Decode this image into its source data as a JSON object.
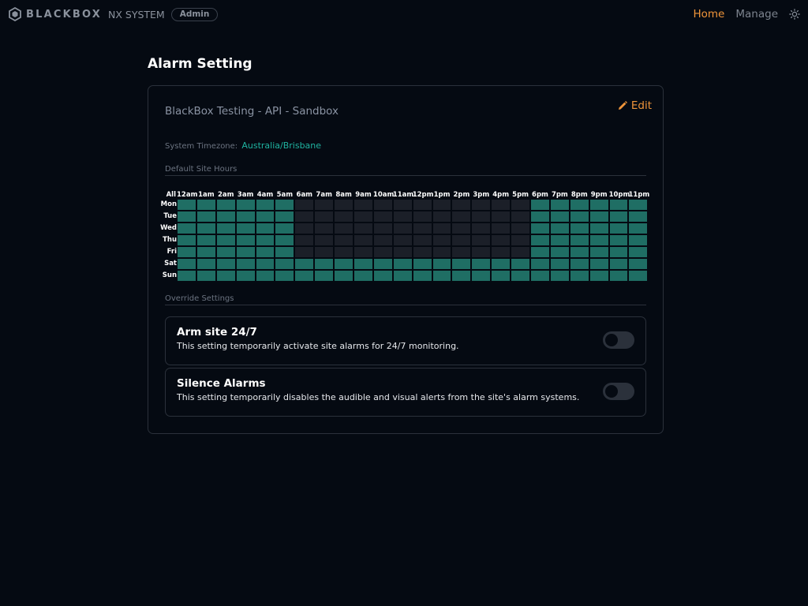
{
  "brand": {
    "name": "BLACKBOX",
    "sub": "NX SYSTEM",
    "role": "Admin"
  },
  "nav": {
    "home": "Home",
    "manage": "Manage",
    "theme_icon": "sun-icon"
  },
  "page": {
    "title": "Alarm Setting"
  },
  "card": {
    "site_name": "BlackBox Testing - API - Sandbox",
    "edit_label": "Edit",
    "timezone_label": "System Timezone:",
    "timezone_value": "Australia/Brisbane",
    "default_hours_label": "Default Site Hours",
    "override_label": "Override Settings"
  },
  "schedule": {
    "all_label": "All",
    "hours": [
      "12am",
      "1am",
      "2am",
      "3am",
      "4am",
      "5am",
      "6am",
      "7am",
      "8am",
      "9am",
      "10am",
      "11am",
      "12pm",
      "1pm",
      "2pm",
      "3pm",
      "4pm",
      "5pm",
      "6pm",
      "7pm",
      "8pm",
      "9pm",
      "10pm",
      "11pm"
    ],
    "days": [
      "Mon",
      "Tue",
      "Wed",
      "Thu",
      "Fri",
      "Sat",
      "Sun"
    ],
    "grid": [
      [
        1,
        1,
        1,
        1,
        1,
        1,
        0,
        0,
        0,
        0,
        0,
        0,
        0,
        0,
        0,
        0,
        0,
        0,
        1,
        1,
        1,
        1,
        1,
        1
      ],
      [
        1,
        1,
        1,
        1,
        1,
        1,
        0,
        0,
        0,
        0,
        0,
        0,
        0,
        0,
        0,
        0,
        0,
        0,
        1,
        1,
        1,
        1,
        1,
        1
      ],
      [
        1,
        1,
        1,
        1,
        1,
        1,
        0,
        0,
        0,
        0,
        0,
        0,
        0,
        0,
        0,
        0,
        0,
        0,
        1,
        1,
        1,
        1,
        1,
        1
      ],
      [
        1,
        1,
        1,
        1,
        1,
        1,
        0,
        0,
        0,
        0,
        0,
        0,
        0,
        0,
        0,
        0,
        0,
        0,
        1,
        1,
        1,
        1,
        1,
        1
      ],
      [
        1,
        1,
        1,
        1,
        1,
        1,
        0,
        0,
        0,
        0,
        0,
        0,
        0,
        0,
        0,
        0,
        0,
        0,
        1,
        1,
        1,
        1,
        1,
        1
      ],
      [
        1,
        1,
        1,
        1,
        1,
        1,
        1,
        1,
        1,
        1,
        1,
        1,
        1,
        1,
        1,
        1,
        1,
        1,
        1,
        1,
        1,
        1,
        1,
        1
      ],
      [
        1,
        1,
        1,
        1,
        1,
        1,
        1,
        1,
        1,
        1,
        1,
        1,
        1,
        1,
        1,
        1,
        1,
        1,
        1,
        1,
        1,
        1,
        1,
        1
      ]
    ]
  },
  "overrides": [
    {
      "title": "Arm site 24/7",
      "description": "This setting temporarily activate site alarms for 24/7 monitoring.",
      "enabled": false
    },
    {
      "title": "Silence Alarms",
      "description": "This setting temporarily disables the audible and visual alerts from the site's alarm systems.",
      "enabled": false
    }
  ],
  "colors": {
    "accent": "#f0953a",
    "armed": "#1f6e64",
    "disarmed": "#1b1f28",
    "timezone": "#1fb3a0"
  }
}
